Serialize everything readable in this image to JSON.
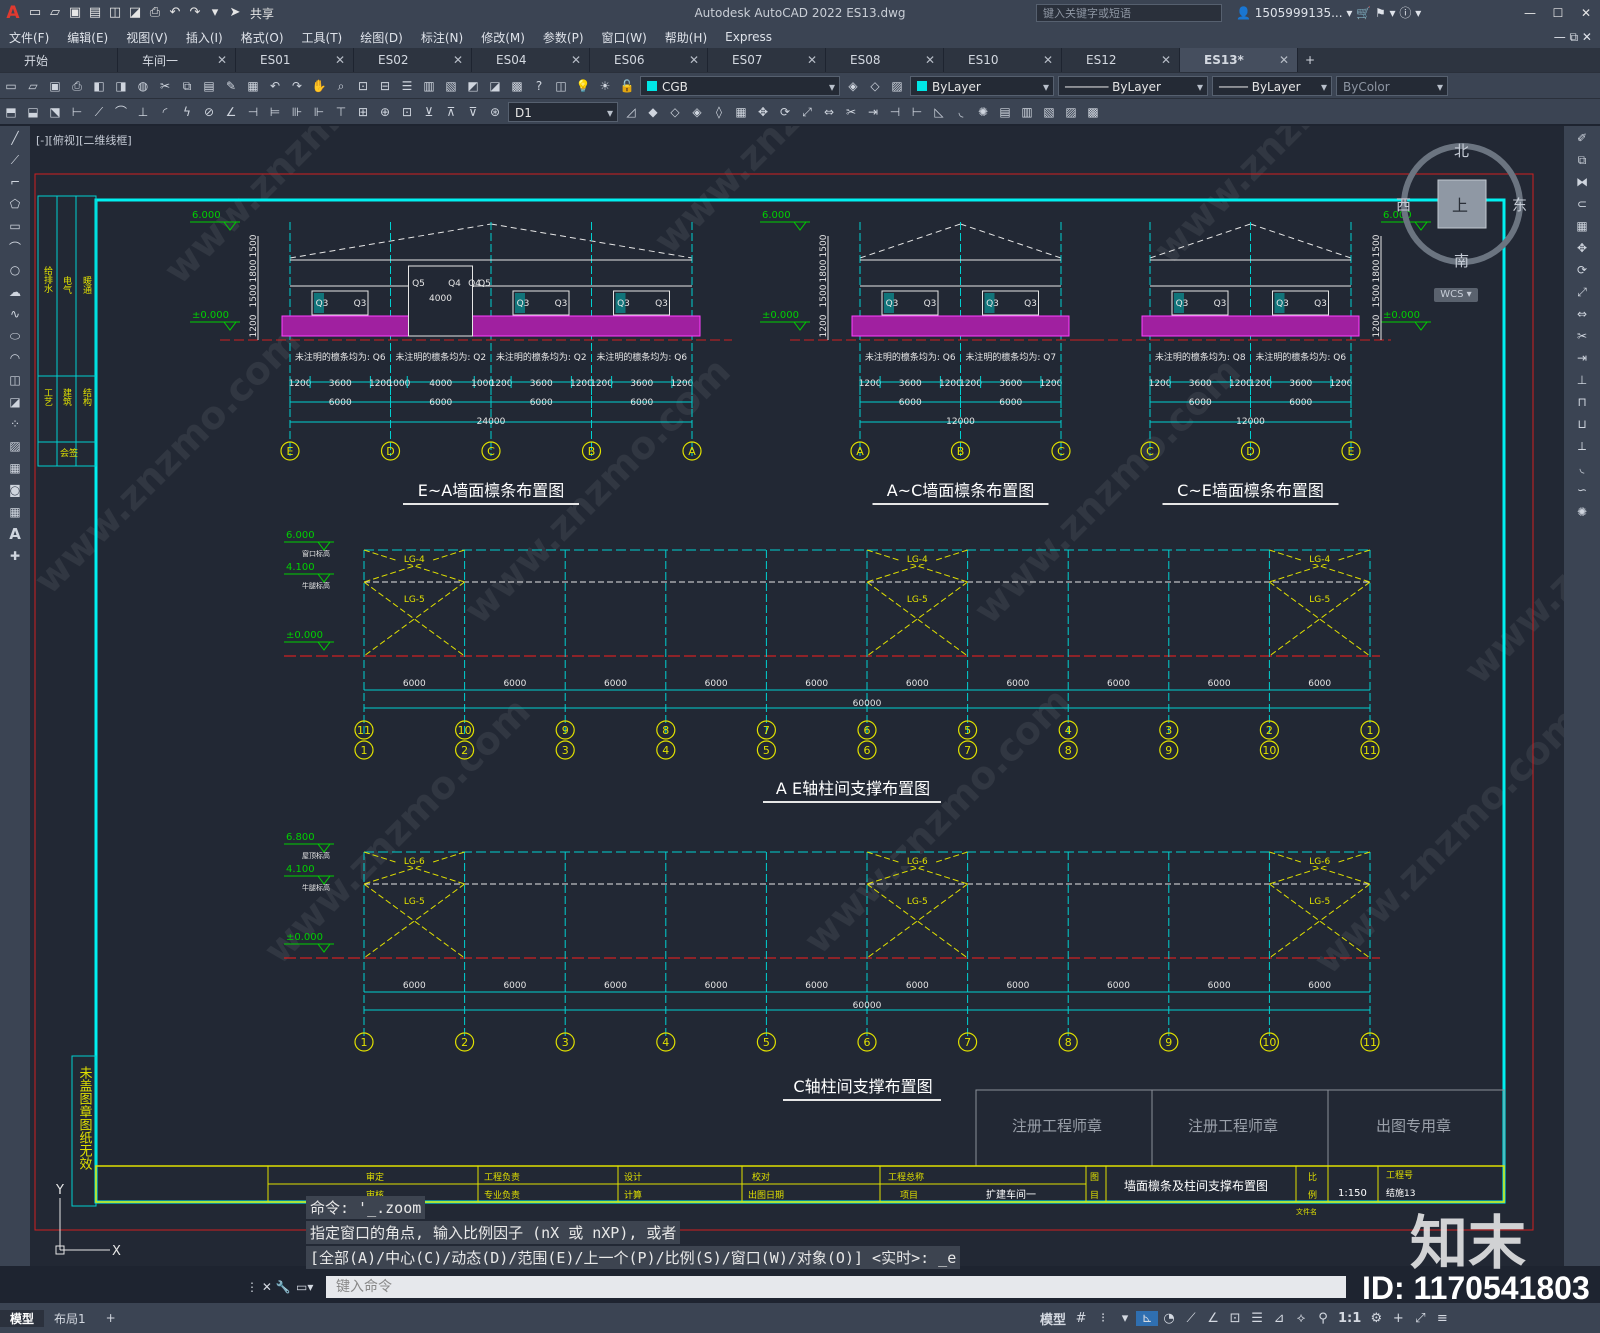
{
  "app": {
    "logo": "A",
    "share_label": "共享",
    "title": "Autodesk AutoCAD 2022    ES13.dwg",
    "search_placeholder": "键入关键字或短语",
    "user": "1505999135..."
  },
  "menu": [
    "文件(F)",
    "编辑(E)",
    "视图(V)",
    "插入(I)",
    "格式(O)",
    "工具(T)",
    "绘图(D)",
    "标注(N)",
    "修改(M)",
    "参数(P)",
    "窗口(W)",
    "帮助(H)",
    "Express"
  ],
  "tabs": [
    "开始",
    "车间一",
    "ES01",
    "ES02",
    "ES04",
    "ES06",
    "ES07",
    "ES08",
    "ES10",
    "ES12",
    "ES13*"
  ],
  "toolbar": {
    "layer": "CGB",
    "color": "ByLayer",
    "linetype": "ByLayer",
    "lineweight": "ByLayer",
    "plotstyle": "ByColor",
    "dimstyle": "D1"
  },
  "viewport": {
    "label": "[-][俯视][二维线框]",
    "compass": {
      "n": "北",
      "s": "南",
      "e": "东",
      "w": "西",
      "top": "上",
      "wcs": "WCS"
    }
  },
  "drawing": {
    "elev1": {
      "title": "E~A墙面檩条布置图",
      "level_top": "6.000",
      "level_zero": "±0.000",
      "notes": [
        "未注明的檩条均为: Q6",
        "未注明的檩条均为: Q2",
        "未注明的檩条均为: Q2",
        "未注明的檩条均为: Q6"
      ],
      "dims_small": [
        "1200",
        "3600",
        "1200",
        "1000",
        "4000",
        "1000",
        "1200",
        "3600",
        "1200",
        "1200",
        "3600",
        "1200"
      ],
      "dims_bays": [
        "6000",
        "6000",
        "6000",
        "6000"
      ],
      "total": "24000",
      "axes": [
        "E",
        "D",
        "C",
        "B",
        "A"
      ],
      "side_dims": [
        "1500",
        "1800",
        "1500",
        "1200"
      ],
      "tags": [
        "Q3",
        "Q3",
        "Q5",
        "Q4",
        "Q4",
        "Q5",
        "Q3",
        "Q3",
        "Q3",
        "Q3"
      ],
      "door": "4000"
    },
    "elev2": {
      "title": "A~C墙面檩条布置图",
      "level_top": "6.000",
      "level_zero": "±0.000",
      "notes": [
        "未注明的檩条均为: Q6",
        "未注明的檩条均为: Q7"
      ],
      "dims_small": [
        "1200",
        "3600",
        "1200",
        "1200",
        "3600",
        "1200"
      ],
      "dims_bays": [
        "6000",
        "6000"
      ],
      "total": "12000",
      "axes": [
        "A",
        "B",
        "C"
      ],
      "side_dims": [
        "1500",
        "1800",
        "1500",
        "1200"
      ],
      "tags": [
        "Q3",
        "Q3",
        "Q3",
        "Q3"
      ]
    },
    "elev3": {
      "title": "C~E墙面檩条布置图",
      "level_top": "6.000",
      "level_zero": "±0.000",
      "notes": [
        "未注明的檩条均为: Q8",
        "未注明的檩条均为: Q6"
      ],
      "dims_small": [
        "1200",
        "3600",
        "1200",
        "1200",
        "3600",
        "1200"
      ],
      "dims_bays": [
        "6000",
        "6000"
      ],
      "total": "12000",
      "axes": [
        "C",
        "D",
        "E"
      ],
      "side_dims": [
        "1500",
        "1800",
        "1500",
        "1200"
      ],
      "tags": [
        "Q3",
        "Q3",
        "Q3",
        "Q3"
      ]
    },
    "brace1": {
      "title": "A E轴柱间支撑布置图",
      "levels": [
        "6.000",
        "4.100",
        "±0.000"
      ],
      "level_notes": [
        "窗口标高",
        "牛腿标高"
      ],
      "tags_upper": "LG-4",
      "tags_lower": "LG-5",
      "bays": [
        "6000",
        "6000",
        "6000",
        "6000",
        "6000",
        "6000",
        "6000",
        "6000",
        "6000",
        "6000"
      ],
      "total": "60000",
      "axes_top": [
        "11",
        "10",
        "9",
        "8",
        "7",
        "6",
        "5",
        "4",
        "3",
        "2",
        "1"
      ],
      "axes_bottom": [
        "1",
        "2",
        "3",
        "4",
        "5",
        "6",
        "7",
        "8",
        "9",
        "10",
        "11"
      ]
    },
    "brace2": {
      "title": "C轴柱间支撑布置图",
      "levels": [
        "6.800",
        "4.100",
        "±0.000"
      ],
      "level_notes": [
        "屋顶标高",
        "牛腿标高"
      ],
      "tags_upper": "LG-6",
      "tags_lower": "LG-5",
      "bays": [
        "6000",
        "6000",
        "6000",
        "6000",
        "6000",
        "6000",
        "6000",
        "6000",
        "6000",
        "6000"
      ],
      "total": "60000",
      "axes": [
        "1",
        "2",
        "3",
        "4",
        "5",
        "6",
        "7",
        "8",
        "9",
        "10",
        "11"
      ]
    },
    "left_strip": [
      "给排水",
      "电气",
      "暖通",
      "工艺",
      "建筑",
      "结构",
      "会签"
    ],
    "stamp_note": "未盖图章图纸无效",
    "stamps": [
      "注册工程师章",
      "注册工程师章",
      "出图专用章"
    ],
    "titleblock": {
      "cells": [
        "审定",
        "审核",
        "工程负责",
        "专业负责",
        "设计",
        "计算",
        "校对",
        "出图日期",
        "工程总称",
        "项目",
        "扩建车间一",
        "图",
        "目",
        "墙面檩条及柱间支撑布置图",
        "比",
        "例",
        "1:150",
        "工程号",
        "文件名",
        "结施13"
      ]
    }
  },
  "commandline": {
    "history": [
      "命令: '_.zoom",
      "指定窗口的角点, 输入比例因子 (nX 或 nXP), 或者",
      "[全部(A)/中心(C)/动态(D)/范围(E)/上一个(P)/比例(S)/窗口(W)/对象(O)] <实时>: _e"
    ],
    "placeholder": "键入命令"
  },
  "statusbar": {
    "tabs": [
      "模型",
      "布局1"
    ],
    "model_label": "模型",
    "scale": "1:1"
  },
  "watermarks": {
    "brand": "知末",
    "id": "ID: 1170541803",
    "site": "www.znzmo.com"
  }
}
